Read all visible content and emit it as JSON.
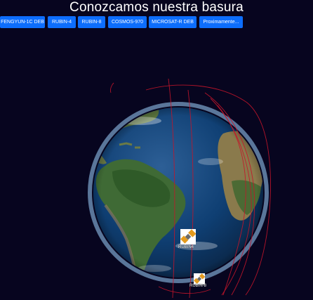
{
  "header": {
    "title": "Conozcamos nuestra basura"
  },
  "toolbar": {
    "buttons": [
      {
        "label": "FENGYUN-1C DEB"
      },
      {
        "label": "RUBIN-4"
      },
      {
        "label": "RUBIN-8"
      },
      {
        "label": "COSMOS-970"
      },
      {
        "label": "MICROSAT-R DEB"
      },
      {
        "label": "Proximamente..."
      }
    ]
  },
  "satellites": [
    {
      "label": "RUBIN4",
      "icon": "satellite-icon"
    },
    {
      "label": "RUBIN-8",
      "icon": "satellite-icon"
    }
  ],
  "colors": {
    "button": "#0d6efd",
    "background": "#07051f",
    "orbit": "#c4152a"
  }
}
